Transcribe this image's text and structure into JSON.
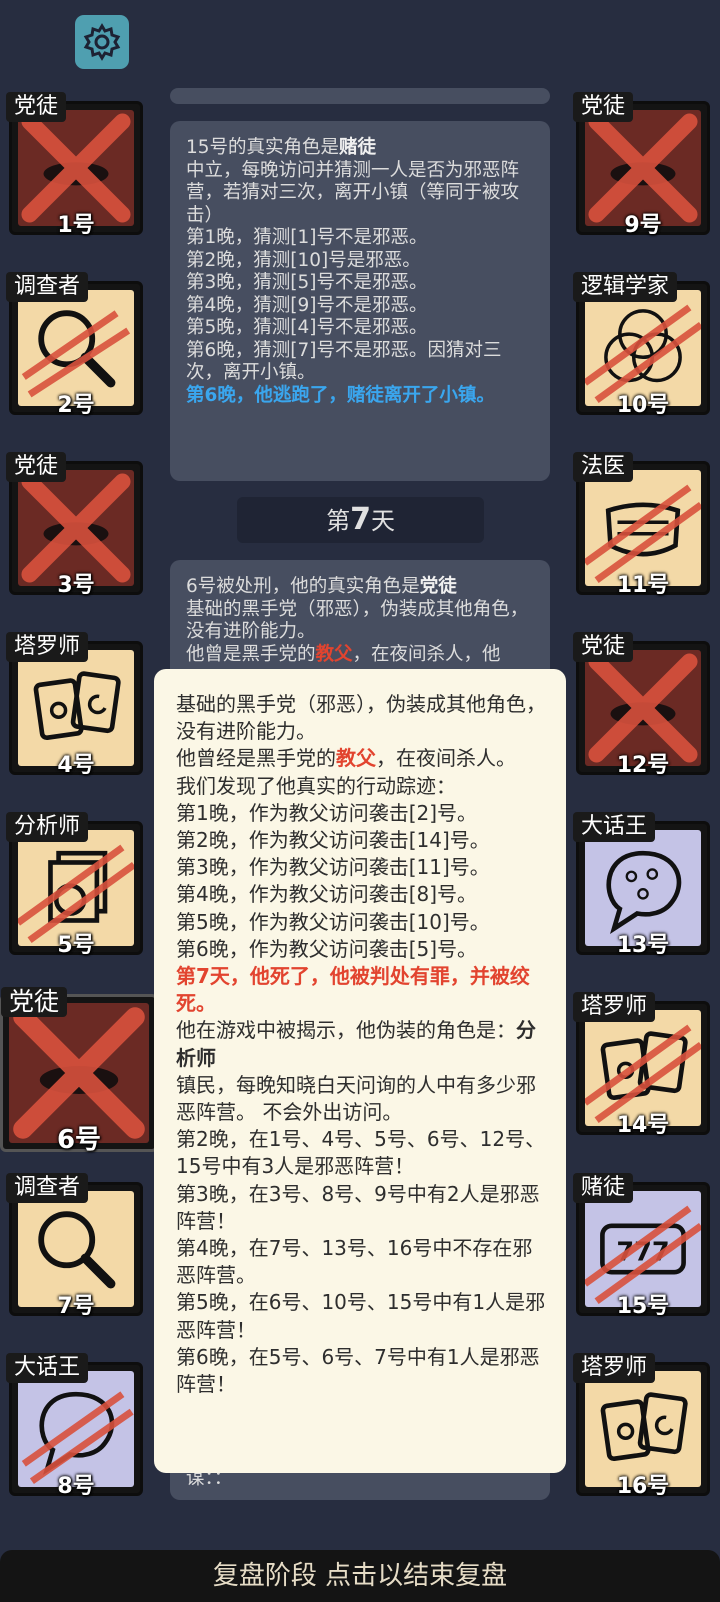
{
  "roles": {
    "c1": "党徒",
    "c2": "调查者",
    "c3": "党徒",
    "c4": "塔罗师",
    "c5": "分析师",
    "c6": "党徒",
    "c7": "调查者",
    "c8": "大话王",
    "c9": "党徒",
    "c10": "逻辑学家",
    "c11": "法医",
    "c12": "党徒",
    "c13": "大话王",
    "c14": "塔罗师",
    "c15": "赌徒",
    "c16": "塔罗师"
  },
  "numbers": {
    "c1": "1号",
    "c2": "2号",
    "c3": "3号",
    "c4": "4号",
    "c5": "5号",
    "c6": "6号",
    "c7": "7号",
    "c8": "8号",
    "c9": "9号",
    "c10": "10号",
    "c11": "11号",
    "c12": "12号",
    "c13": "13号",
    "c14": "14号",
    "c15": "15号",
    "c16": "16号"
  },
  "log1": {
    "line1": "15号的真实角色是",
    "line1_role": "赌徒",
    "line2": "中立，每晚访问并猜测一人是否为邪恶阵营，若猜对三次，离开小镇（等同于被攻击）",
    "n1": "第1晚，猜测[1]号不是邪恶。",
    "n2": "第2晚，猜测[10]号是邪恶。",
    "n3": "第3晚，猜测[5]号不是邪恶。",
    "n4": "第4晚，猜测[9]号不是邪恶。",
    "n5": "第5晚，猜测[4]号不是邪恶。",
    "n6": "第6晚，猜测[7]号不是邪恶。因猜对三次，离开小镇。",
    "result": "第6晚，他逃跑了，赌徒离开了小镇。"
  },
  "day": {
    "prefix": "第",
    "number": "7",
    "suffix": "天"
  },
  "log2": {
    "line1": "6号被处刑，他的真实角色是",
    "line1_role": "党徒",
    "line2": "基础的黑手党（邪恶），伪装成其他角色，没有进阶能力。",
    "line3": "他曾是黑手党的",
    "line3_role": "教父",
    "line3_rest": "，在夜间杀人，他",
    "tail": "谋：："
  },
  "popup": {
    "p1": "基础的黑手党（邪恶），伪装成其他角色，没有进阶能力。",
    "p2a": "他曾经是黑手党的",
    "p2_role": "教父",
    "p2b": "，在夜间杀人。",
    "p3": "我们发现了他真实的行动踪迹：",
    "a1": "第1晚，作为教父访问袭击[2]号。",
    "a2": "第2晚，作为教父访问袭击[14]号。",
    "a3": "第3晚，作为教父访问袭击[11]号。",
    "a4": "第4晚，作为教父访问袭击[8]号。",
    "a5": "第5晚，作为教父访问袭击[10]号。",
    "a6": "第6晚，作为教父访问袭击[5]号。",
    "death": "第7天，他死了，他被判处有罪，并被绞死。",
    "reveal": "他在游戏中被揭示，他伪装的角色是：",
    "reveal_role": "分析师",
    "desc": "镇民，每晚知晓白天问询的人中有多少邪恶阵营。 不会外出访问。",
    "r2": "第2晚，在1号、4号、5号、6号、12号、15号中有3人是邪恶阵营！",
    "r3": "第3晚，在3号、8号、9号中有2人是邪恶阵营！",
    "r4": "第4晚，在7号、13号、16号中不存在邪恶阵营。",
    "r5": "第5晚，在6号、10号、15号中有1人是邪恶阵营！",
    "r6": "第6晚，在5号、6号、7号中有1人是邪恶阵营！"
  },
  "bottom": {
    "label": "复盘阶段 点击以结束复盘"
  },
  "icons": {
    "settings": "gear-icon"
  }
}
